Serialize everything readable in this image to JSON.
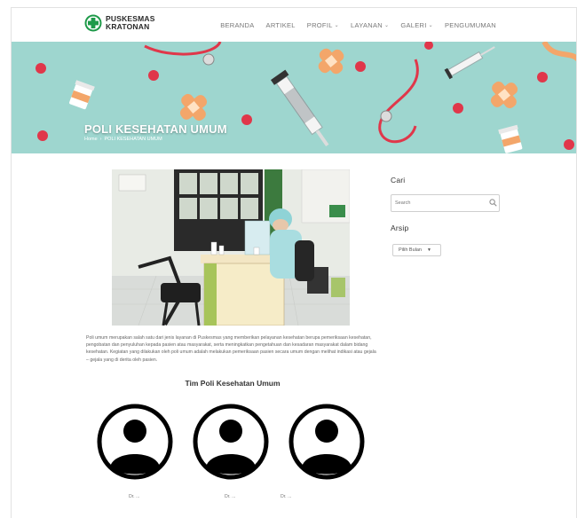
{
  "header": {
    "logo_line1": "PUSKESMAS",
    "logo_line2": "KRATONAN",
    "nav": [
      {
        "label": "BERANDA",
        "has_dropdown": false
      },
      {
        "label": "ARTIKEL",
        "has_dropdown": false
      },
      {
        "label": "PROFIL",
        "has_dropdown": true
      },
      {
        "label": "LAYANAN",
        "has_dropdown": true
      },
      {
        "label": "GALERI",
        "has_dropdown": true
      },
      {
        "label": "PENGUMUMAN",
        "has_dropdown": false
      }
    ]
  },
  "hero": {
    "title": "POLI KESEHATAN UMUM",
    "breadcrumb_home": "Home",
    "breadcrumb_sep": "›",
    "breadcrumb_current": "POLI KESEHATAN UMUM"
  },
  "article": {
    "body": "Poli umum merupakan salah satu dari jenis layanan di Puskesmas  yang memberikan pelayanan kesehatan berupa pemeriksaan kesehatan, pengobatan dan penyuluhan kepada pasien atau masyarakat, serta meningkatkan pengetahuan dan kesadaran masyarakat dalam bidang kesehatan. Kegiatan yang dilakukan oleh poli umum adalah melakukan pemeriksaan pasien secara umum dengan melihat indikasi atau gejala – gejala yang di derita oleh pasien."
  },
  "team": {
    "title": "Tim Poli Kesehatan Umum",
    "members": [
      {
        "label": "Dr. ..."
      },
      {
        "label": "Dr. ..."
      },
      {
        "label": "Dr. ..."
      }
    ]
  },
  "sidebar": {
    "search_title": "Cari",
    "search_placeholder": "Search",
    "archive_title": "Arsip",
    "archive_selected": "Pilih Bulan"
  },
  "colors": {
    "hero_bg": "#9ed6cf",
    "logo_green": "#1f9a4a",
    "pill_red": "#e0374a",
    "bandage_orange": "#f3a66a"
  }
}
